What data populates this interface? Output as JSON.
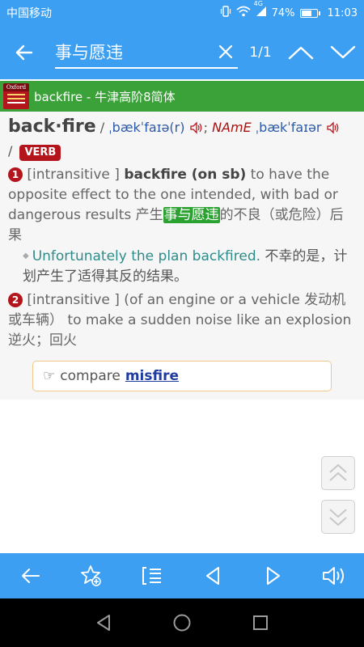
{
  "status": {
    "carrier": "中国移动",
    "network": "4G",
    "battery_text": "74%",
    "battery_level": 0.74,
    "time": "11:03"
  },
  "search": {
    "query": "事与愿违",
    "match_count": "1/1"
  },
  "dictionary": {
    "logo_text": "Oxford",
    "title": "backfire - 牛津高阶8简体"
  },
  "entry": {
    "headword": "back·fire",
    "sep1": " / ",
    "pron_br": "ˌbækˈfaɪə(r)",
    "semicolon": "; ",
    "region": "NAmE",
    "pron_us": " ˌbækˈfaɪər",
    "slash2": "/ ",
    "pos": "VERB",
    "senses": [
      {
        "num": "1",
        "grammar": "[intransitive ] ",
        "phrase": "backfire (on sb)",
        "def_before": "  to have the opposite effect to the one intended, with bad or dangerous results 产生",
        "def_highlight": "事与愿违",
        "def_after": "的不良（或危险）后果",
        "example_en": "Unfortunately the plan backfired.",
        "example_zh": " 不幸的是，计划产生了适得其反的结果。"
      },
      {
        "num": "2",
        "text": "[intransitive ] (of an engine or a vehicle 发动机或车辆） to make a sudden noise like an explosion 逆火；回火"
      }
    ],
    "compare_label": "compare",
    "compare_link": "misfire"
  },
  "colors": {
    "primary": "#3c9ff1",
    "dict_strip": "#3aa238",
    "accent_red": "#b4151c",
    "highlight": "#2aa230"
  }
}
